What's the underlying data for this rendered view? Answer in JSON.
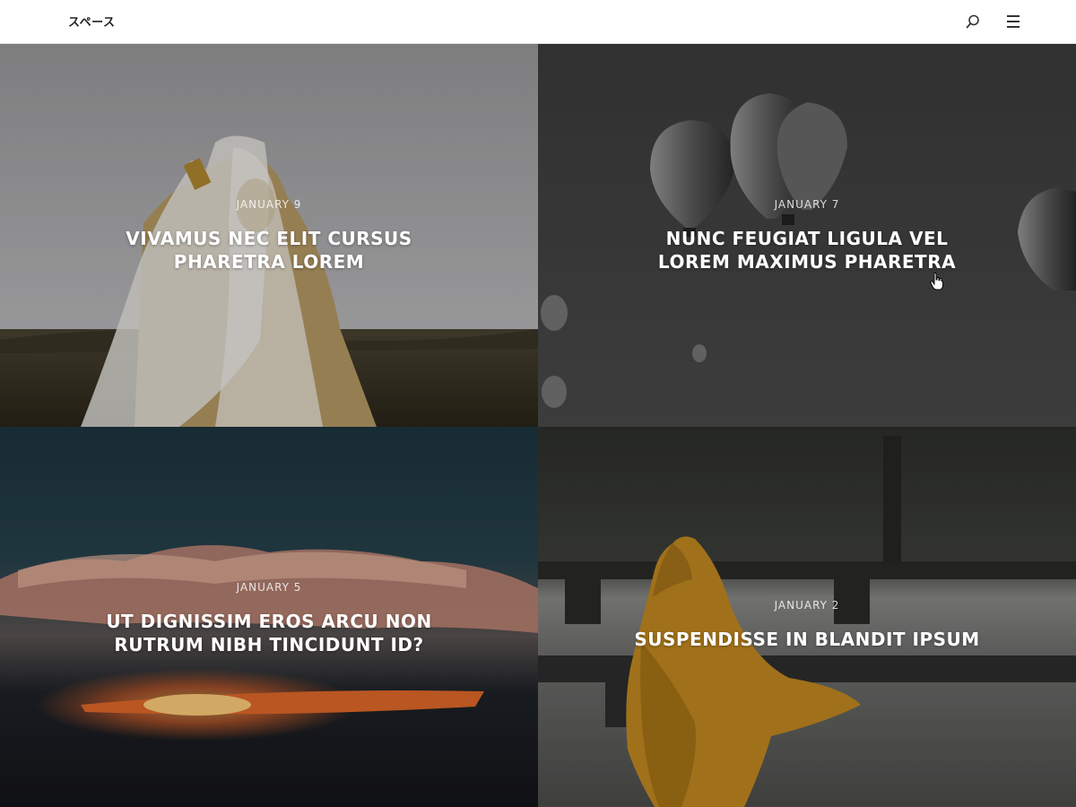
{
  "header": {
    "site_title": "スペース",
    "search_icon": "search-icon",
    "menu_icon": "hamburger-menu-icon"
  },
  "posts": [
    {
      "date": "JANUARY 9",
      "title": "VIVAMUS NEC ELIT CURSUS PHARETRA LOREM"
    },
    {
      "date": "JANUARY 7",
      "title": "NUNC FEUGIAT LIGULA VEL LOREM MAXIMUS PHARETRA"
    },
    {
      "date": "JANUARY 5",
      "title": "UT DIGNISSIM EROS ARCU NON RUTRUM NIBH TINCIDUNT ID?"
    },
    {
      "date": "JANUARY 2",
      "title": "SUSPENDISSE IN BLANDIT IPSUM"
    }
  ],
  "colors": {
    "header_bg": "#ffffff",
    "text_light": "#ffffff"
  }
}
